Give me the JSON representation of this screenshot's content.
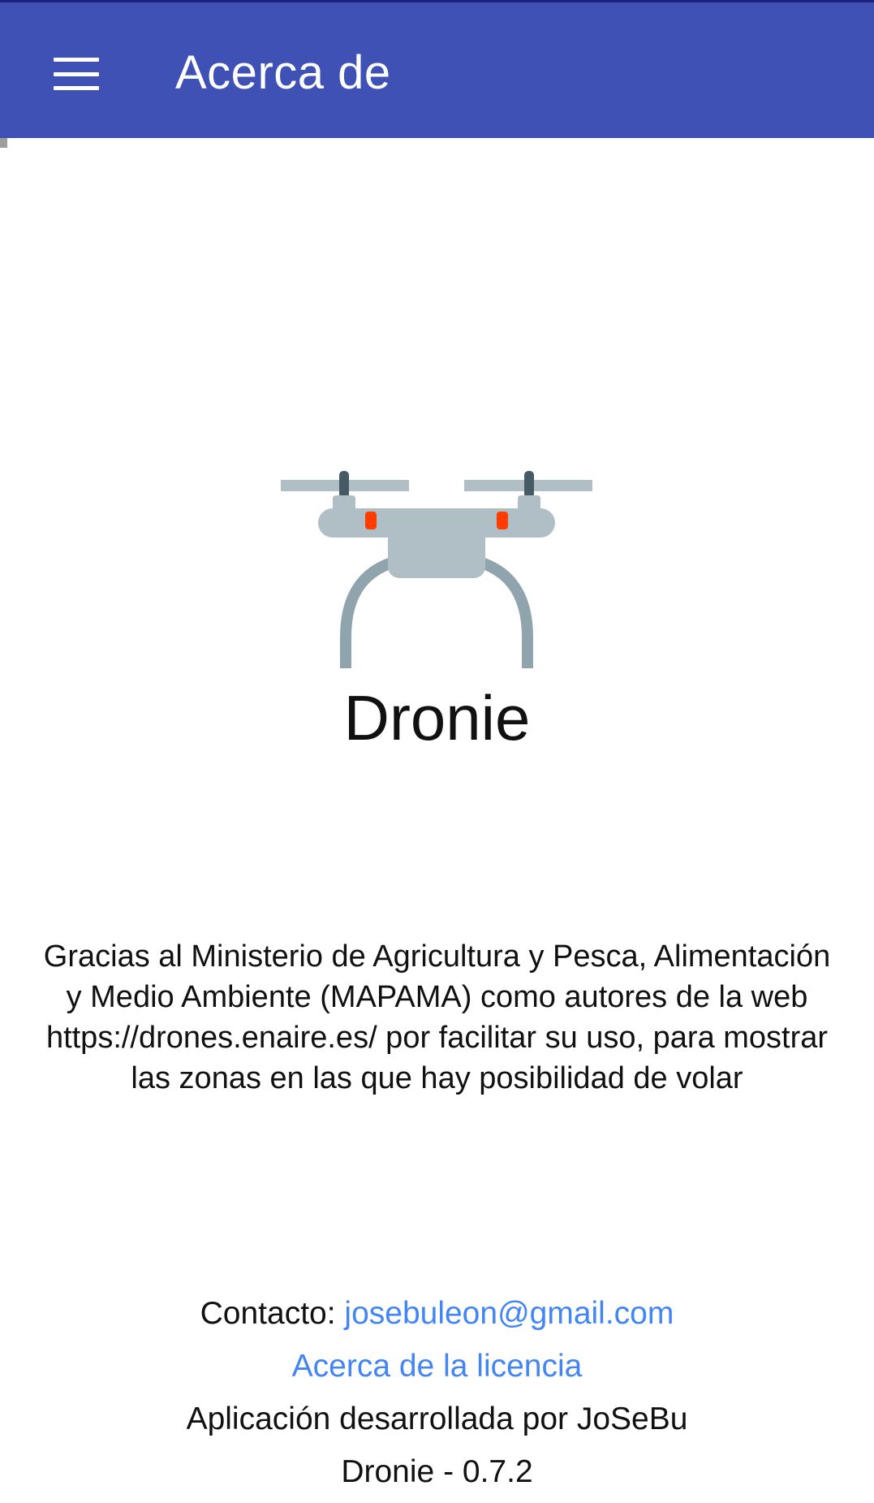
{
  "app_bar": {
    "title": "Acerca de",
    "menu_icon": "hamburger-menu-icon",
    "color": "#3f51b5"
  },
  "logo": {
    "icon": "drone-icon",
    "colors": {
      "body": "#b0bec5",
      "legs": "#90a4ae",
      "motors": "#455a64",
      "lights": "#ff3d00"
    }
  },
  "app_name": "Dronie",
  "thanks_text": "Gracias al Ministerio de Agricultura y Pesca, Alimentación y Medio Ambiente (MAPAMA) como autores de la web https://drones.enaire.es/ por facilitar su uso, para mostrar las zonas en las que hay posibilidad de volar",
  "footer": {
    "contact_label": "Contacto: ",
    "contact_email": "josebuleon@gmail.com",
    "license_link": "Acerca de la licencia",
    "developed_by": "Aplicación desarrollada por JoSeBu",
    "version": "Dronie - 0.7.2",
    "link_color": "#4285f4"
  }
}
